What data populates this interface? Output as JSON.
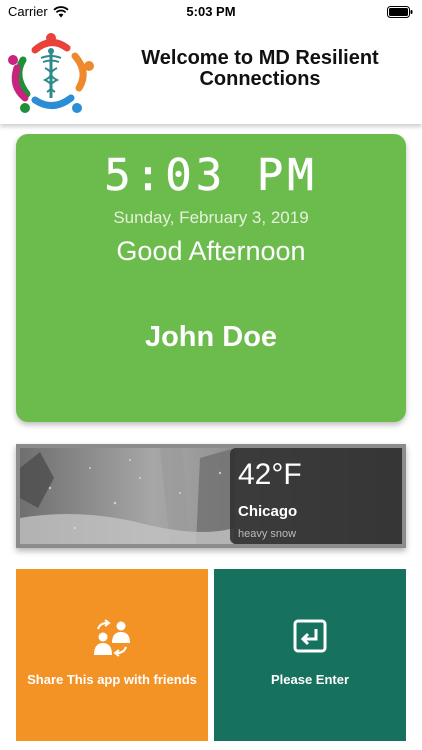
{
  "status_bar": {
    "carrier": "Carrier",
    "time": "5:03 PM",
    "icons": [
      "wifi-icon",
      "battery-icon"
    ]
  },
  "header": {
    "title": "Welcome to MD Resilient Connections",
    "logo_icon": "caduceus-people-logo"
  },
  "greeting_card": {
    "clock": "5:03 PM",
    "date": "Sunday, February 3, 2019",
    "greeting": "Good Afternoon",
    "user_name": "John Doe",
    "color": "#6cbb4d"
  },
  "weather": {
    "temperature": "42°F",
    "city": "Chicago",
    "condition": "heavy snow"
  },
  "actions": {
    "share": {
      "label": "Share This app with friends",
      "icon": "share-people-icon",
      "color": "#f39325"
    },
    "enter": {
      "label": "Please Enter",
      "icon": "enter-icon",
      "color": "#16725f"
    }
  }
}
